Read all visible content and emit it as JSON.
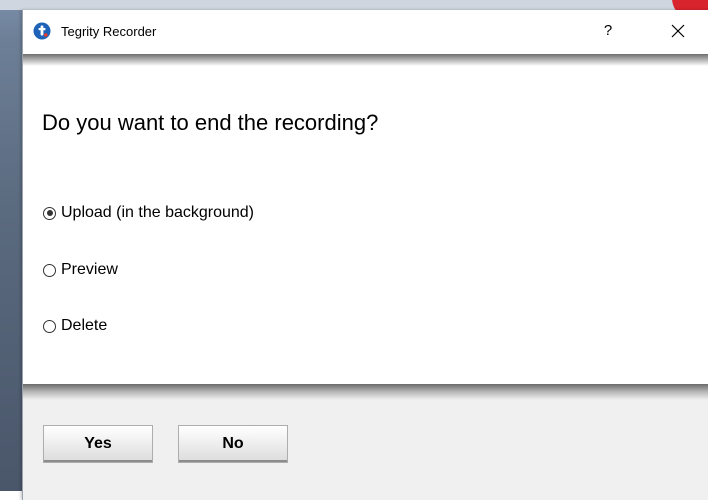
{
  "window": {
    "title": "Tegrity Recorder",
    "help_label": "?",
    "app_icon": "tegrity-logo-icon",
    "close_icon": "close-icon"
  },
  "dialog": {
    "question": "Do you want to end the recording?",
    "options": [
      {
        "label": "Upload (in the background)",
        "checked": true
      },
      {
        "label": "Preview",
        "checked": false
      },
      {
        "label": "Delete",
        "checked": false
      }
    ]
  },
  "buttons": {
    "yes_label": "Yes",
    "no_label": "No"
  },
  "colors": {
    "logo": "#1f63b8",
    "logo_accent": "#e23b2f"
  }
}
